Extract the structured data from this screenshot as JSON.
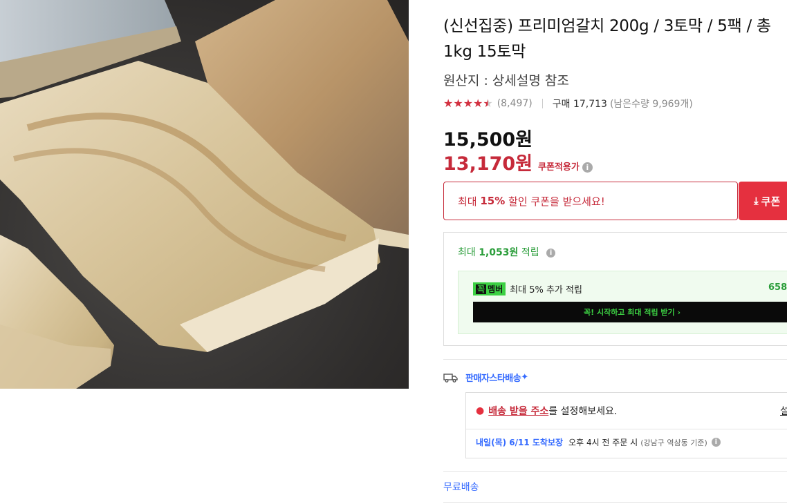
{
  "product": {
    "image_alt": "grilled hairtail fish",
    "title": "(신선집중) 프리미엄갈치 200g / 3토막 / 5팩 / 총 1kg 15토막",
    "origin": "원산지 : 상세설명 참조",
    "rating": 4.5,
    "review_count": "(8,497)",
    "purchase_label": "구매 17,713",
    "remaining_label": "(남은수량 9,969개)"
  },
  "price": {
    "original": "15,500원",
    "sale": "13,170원",
    "coupon_applied": "쿠폰적용가"
  },
  "coupon": {
    "prefix": "최대 ",
    "percent": "15%",
    "suffix": " 할인 쿠폰을 받으세요!",
    "button_label": "쿠폰"
  },
  "reward": {
    "prefix": "최대 ",
    "amount": "1,053원",
    "suffix": " 적립",
    "member_badge_a": "꼭",
    "member_badge_b": "멤버",
    "member_text": "최대 5% 추가 적립",
    "member_amount": "658",
    "start_button": "꼭! 시작하고 최대 적립 받기 ›"
  },
  "delivery": {
    "badge": "판매자스타배송",
    "address_link": "배송 받을 주소",
    "address_suffix": "를 설정해보세요.",
    "settings_link": "설",
    "arrival_date": "내일(목) 6/11 도착보장",
    "arrival_condition": "오후 4시 전 주문 시",
    "arrival_note": "(강남구 역삼동 기준)",
    "free_shipping": "무료배송"
  },
  "colors": {
    "accent_red": "#c62a3a",
    "accent_green": "#2a9d3a",
    "accent_blue": "#346aff",
    "member_green": "#3cd043"
  }
}
